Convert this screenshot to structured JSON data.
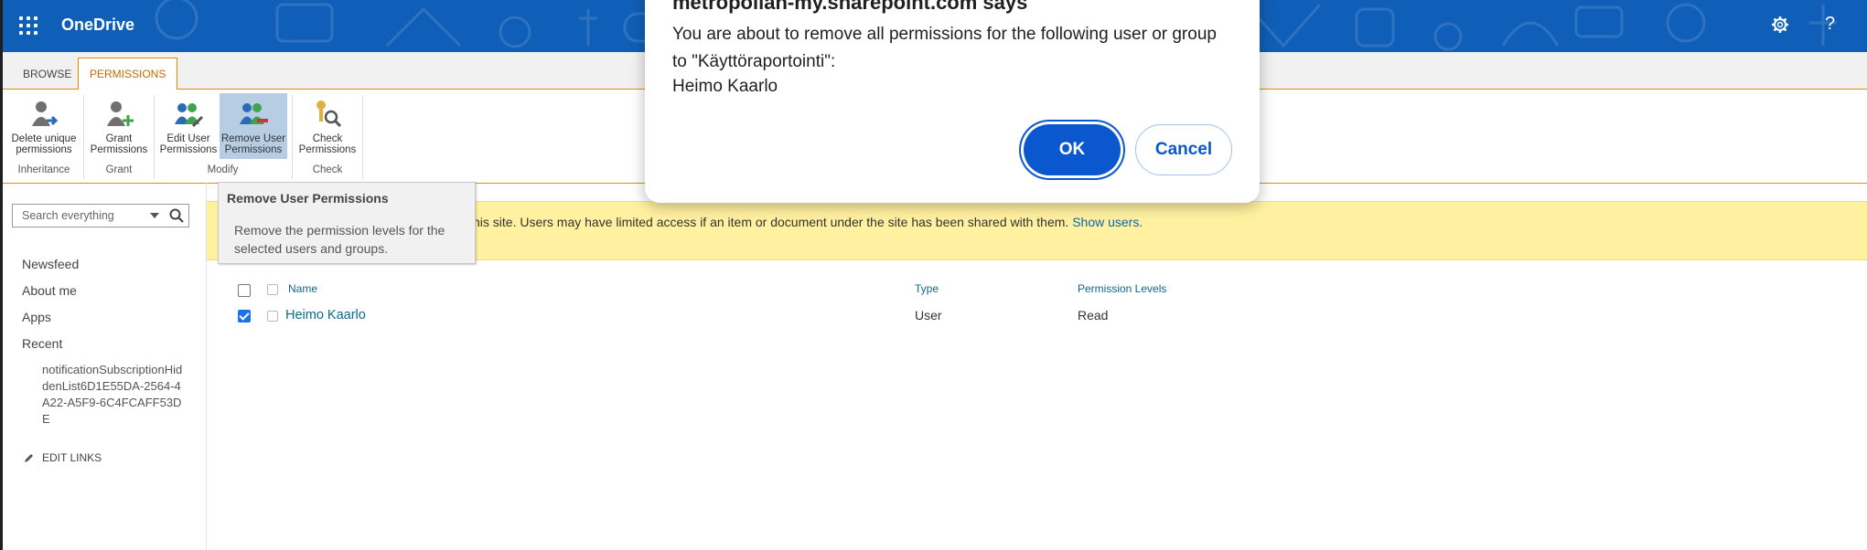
{
  "suitebar": {
    "brand": "OneDrive",
    "settings_icon": "gear-icon",
    "help_icon": "?"
  },
  "ribbon_tabs": [
    {
      "label": "BROWSE",
      "active": false
    },
    {
      "label": "PERMISSIONS",
      "active": true
    }
  ],
  "ribbon": {
    "buttons": [
      {
        "line1": "Delete unique",
        "line2": "permissions",
        "icon": "delete-permissions-icon"
      },
      {
        "line1": "Grant",
        "line2": "Permissions",
        "icon": "grant-permissions-icon"
      },
      {
        "line1": "Edit User",
        "line2": "Permissions",
        "icon": "edit-user-permissions-icon"
      },
      {
        "line1": "Remove User",
        "line2": "Permissions",
        "icon": "remove-user-permissions-icon",
        "selected": true
      },
      {
        "line1": "Check",
        "line2": "Permissions",
        "icon": "check-permissions-icon"
      }
    ],
    "groups": [
      "Inheritance",
      "Grant",
      "Modify",
      "Check"
    ]
  },
  "tooltip": {
    "title": "Remove User Permissions",
    "body": "Remove the permission levels for the selected users and groups."
  },
  "search": {
    "placeholder": "Search everything"
  },
  "leftnav": {
    "items": [
      "Newsfeed",
      "About me",
      "Apps",
      "Recent"
    ],
    "recent_child": "notificationSubscriptionHiddenList6D1E55DA-2564-4A22-A5F9-6C4FCAFF53DE",
    "edit_links": "EDIT LINKS"
  },
  "infobar": {
    "text": "his site. Users may have limited access if an item or document under the site has been shared with them.",
    "link": "Show users."
  },
  "table": {
    "headers": {
      "name": "Name",
      "type": "Type",
      "levels": "Permission Levels"
    },
    "rows": [
      {
        "name": "Heimo Kaarlo",
        "type": "User",
        "levels": "Read",
        "checked": true
      }
    ]
  },
  "dialog": {
    "title": "metropolian-my.sharepoint.com says",
    "message": "You are about to remove all permissions for the following user or group to \"Käyttöraportointi\":",
    "name": "Heimo Kaarlo",
    "ok": "OK",
    "cancel": "Cancel"
  },
  "colors": {
    "suitebar": "#0f5fb8",
    "accent": "#e88a00",
    "dialog_button": "#0b57d0",
    "infobar": "#fff19f"
  }
}
